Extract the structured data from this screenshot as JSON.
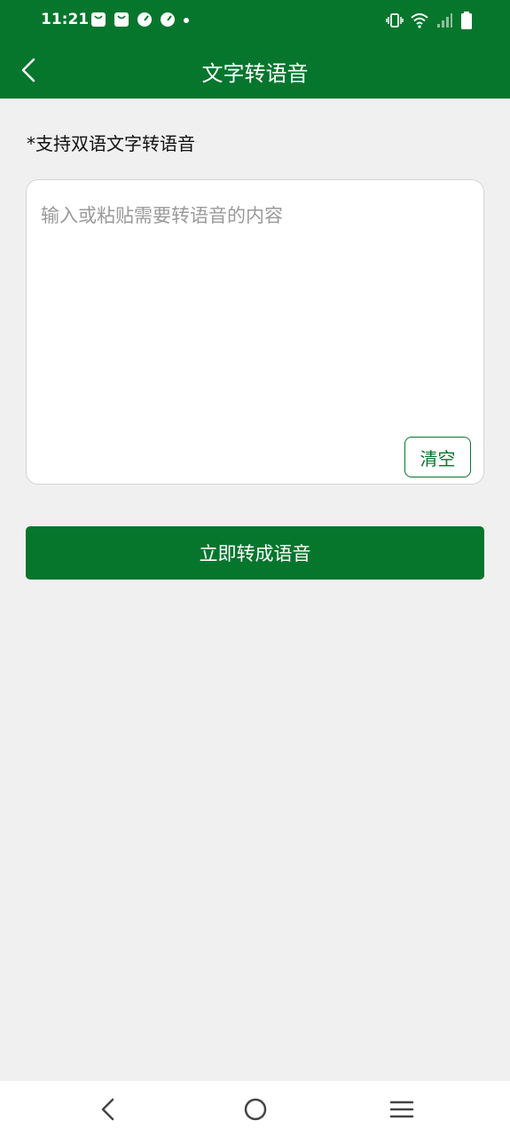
{
  "status_bar": {
    "time": "11:21",
    "notification_icons": [
      "shopping-bag-icon",
      "shopping-bag-icon",
      "speedometer-icon",
      "speedometer-icon",
      "dot-icon"
    ],
    "system_icons": [
      "vibrate-icon",
      "wifi-icon",
      "signal-icon",
      "battery-icon"
    ]
  },
  "app_bar": {
    "title": "文字转语音",
    "back_icon": "back-arrow-icon"
  },
  "hint": "*支持双语文字转语音",
  "input": {
    "value": "",
    "placeholder": "输入或粘贴需要转语音的内容"
  },
  "clear_button": "清空",
  "convert_button": "立即转成语音",
  "nav_bar": {
    "items": [
      "back-icon",
      "home-icon",
      "menu-icon"
    ]
  },
  "colors": {
    "primary": "#06762d",
    "background": "#f0f0f0"
  }
}
